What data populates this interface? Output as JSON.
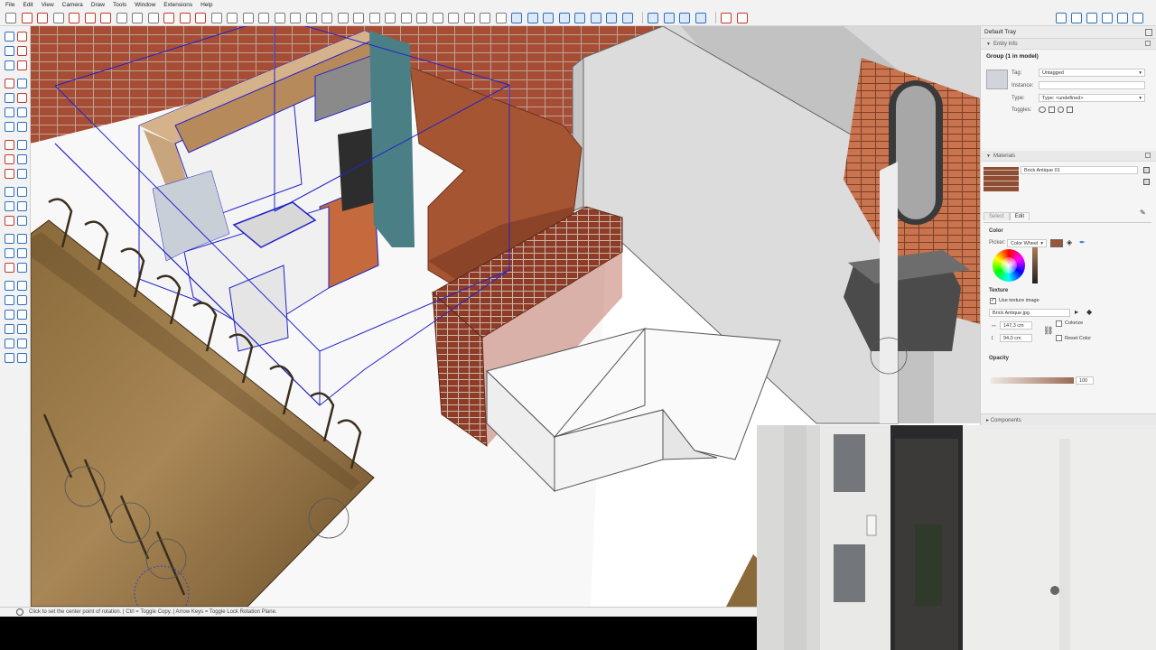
{
  "menu": [
    "File",
    "Edit",
    "View",
    "Camera",
    "Draw",
    "Tools",
    "Window",
    "Extensions",
    "Help"
  ],
  "status": {
    "text": "Click to set the center point of rotation. | Ctrl = Toggle Copy. | Arrow Keys = Toggle Lock Rotation Plane."
  },
  "tray": {
    "title": "Default Tray",
    "entity_info": {
      "header": "Entity Info",
      "group_name": "Group (1 in model)",
      "tag_label": "Tag:",
      "tag_value": "Untagged",
      "instance_label": "Instance:",
      "instance_value": "",
      "type_label": "Type:",
      "type_value": "Type: <undefined>",
      "toggles_label": "Toggles:"
    },
    "materials": {
      "header": "Materials",
      "name": "Brick Antique 01",
      "tab_select": "Select",
      "tab_edit": "Edit",
      "color_heading": "Color",
      "picker_label": "Picker:",
      "picker_value": "Color Wheel",
      "texture_heading": "Texture",
      "use_texture_label": "Use texture image",
      "texture_file": "Brick Antique.jpg",
      "width_value": "147,3 cm",
      "height_value": "94,0 cm",
      "colorize_label": "Colorize",
      "reset_color_label": "Reset Color",
      "opacity_heading": "Opacity",
      "opacity_value": "100",
      "swatch_color": "#9a5439"
    },
    "components_header": "Components"
  }
}
